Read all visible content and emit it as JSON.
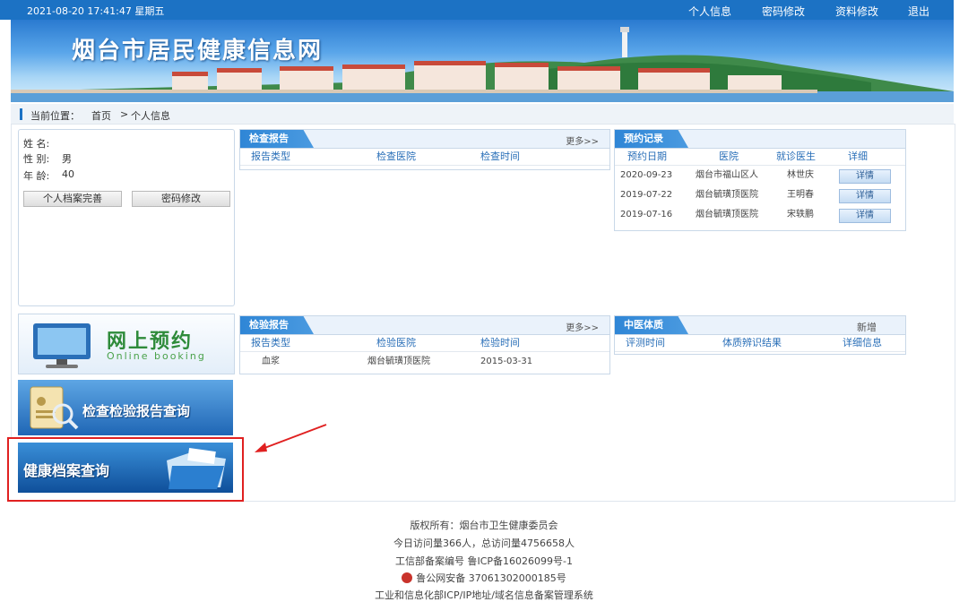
{
  "topbar": {
    "datetime": "2021-08-20 17:41:47 星期五",
    "links": [
      "个人信息",
      "密码修改",
      "资料修改",
      "退出"
    ]
  },
  "banner": {
    "title": "烟台市居民健康信息网"
  },
  "breadcrumb": {
    "label": "当前位置：",
    "home": "首页",
    "sep": ">",
    "current": "个人信息"
  },
  "profile": {
    "name_label": "姓  名:",
    "gender_label": "性  别:",
    "gender": "男",
    "age_label": "年  龄:",
    "age": "40",
    "btn_complete": "个人档案完善",
    "btn_password": "密码修改"
  },
  "side_banners": {
    "booking_cn": "网上预约",
    "booking_en": "Online  booking",
    "report_query": "检查检验报告查询",
    "archive_query": "健康档案查询"
  },
  "exam_report": {
    "title": "检查报告",
    "more": "更多>>",
    "headers": [
      "报告类型",
      "检查医院",
      "检查时间"
    ]
  },
  "lab_report": {
    "title": "检验报告",
    "more": "更多>>",
    "headers": [
      "报告类型",
      "检验医院",
      "检验时间"
    ],
    "rows": [
      [
        "血浆",
        "烟台毓璜顶医院",
        "2015-03-31"
      ]
    ]
  },
  "appointments": {
    "title": "预约记录",
    "headers": [
      "预约日期",
      "医院",
      "就诊医生",
      "详细"
    ],
    "rows": [
      {
        "date": "2020-09-23",
        "hospital": "烟台市福山区人",
        "doctor": "林世庆",
        "detail": "详情"
      },
      {
        "date": "2019-07-22",
        "hospital": "烟台毓璜顶医院",
        "doctor": "王明春",
        "detail": "详情"
      },
      {
        "date": "2019-07-16",
        "hospital": "烟台毓璜顶医院",
        "doctor": "宋轶鹏",
        "detail": "详情"
      }
    ]
  },
  "tcm": {
    "title": "中医体质",
    "new_label": "新增",
    "headers": [
      "评测时间",
      "体质辨识结果",
      "详细信息"
    ]
  },
  "footer": {
    "copyright": "版权所有：烟台市卫生健康委员会",
    "visits": "今日访问量366人，总访问量4756658人",
    "icp": "工信部备案编号 鲁ICP备16026099号-1",
    "police": "鲁公网安备 37061302000185号",
    "system": "工业和信息化部ICP/IP地址/域名信息备案管理系统"
  },
  "colors": {
    "primary": "#1c72c4",
    "highlight": "#e02020"
  }
}
